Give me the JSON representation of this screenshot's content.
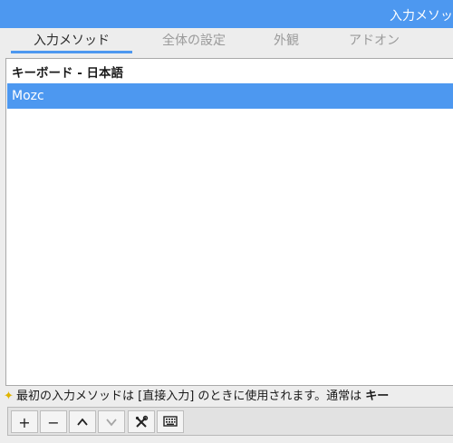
{
  "window": {
    "title": "入力メソッ"
  },
  "tabs": [
    {
      "label": "入力メソッド",
      "active": true
    },
    {
      "label": "全体の設定",
      "active": false
    },
    {
      "label": "外観",
      "active": false
    },
    {
      "label": "アドオン",
      "active": false
    }
  ],
  "method_list": {
    "group_header": "キーボード - 日本語",
    "items": [
      {
        "label": "Mozc",
        "selected": true
      }
    ]
  },
  "hint": {
    "icon": "lightbulb-icon",
    "text_before": "最初の入力メソッドは [直接入力] のときに使用されます。通常は ",
    "text_bold": "キー"
  },
  "toolbar": {
    "add": "+",
    "remove": "−",
    "move_up": "up-chevron-icon",
    "move_down": "down-chevron-icon",
    "configure": "tools-icon",
    "keyboard_layout": "keyboard-icon"
  },
  "colors": {
    "accent": "#4d98f0",
    "panel_bg": "#ffffff",
    "window_bg": "#ededed",
    "hint_icon": "#e0b400"
  }
}
